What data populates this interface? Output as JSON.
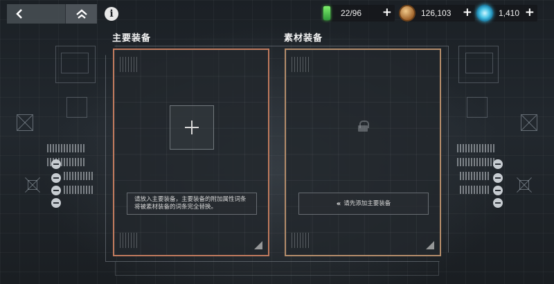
{
  "nav": {
    "back_icon": "chevron-left-icon",
    "home_icon": "double-chevron-up-icon",
    "info_icon": "info-icon",
    "info_glyph": "i"
  },
  "currencies": [
    {
      "name": "energy",
      "icon": "energy-battery-icon",
      "value": "22/96",
      "color": "#5fe05a"
    },
    {
      "name": "gold",
      "icon": "gold-coin-icon",
      "value": "126,103",
      "color": "#c8843f"
    },
    {
      "name": "crystal",
      "icon": "crystal-icon",
      "value": "1,410",
      "color": "#3bc0ea"
    }
  ],
  "main_equipment": {
    "title": "主要装备",
    "hint_line1": "请放入主要装备，主要装备的附加属性词条",
    "hint_line2": "将被素材装备的词条完全替换。",
    "border_color": "#c07a5d"
  },
  "material_equipment": {
    "title": "素材装备",
    "hint": "请先添加主要装备",
    "hint_icon": "double-chevron-left-icon",
    "border_color": "#b48c6a"
  }
}
